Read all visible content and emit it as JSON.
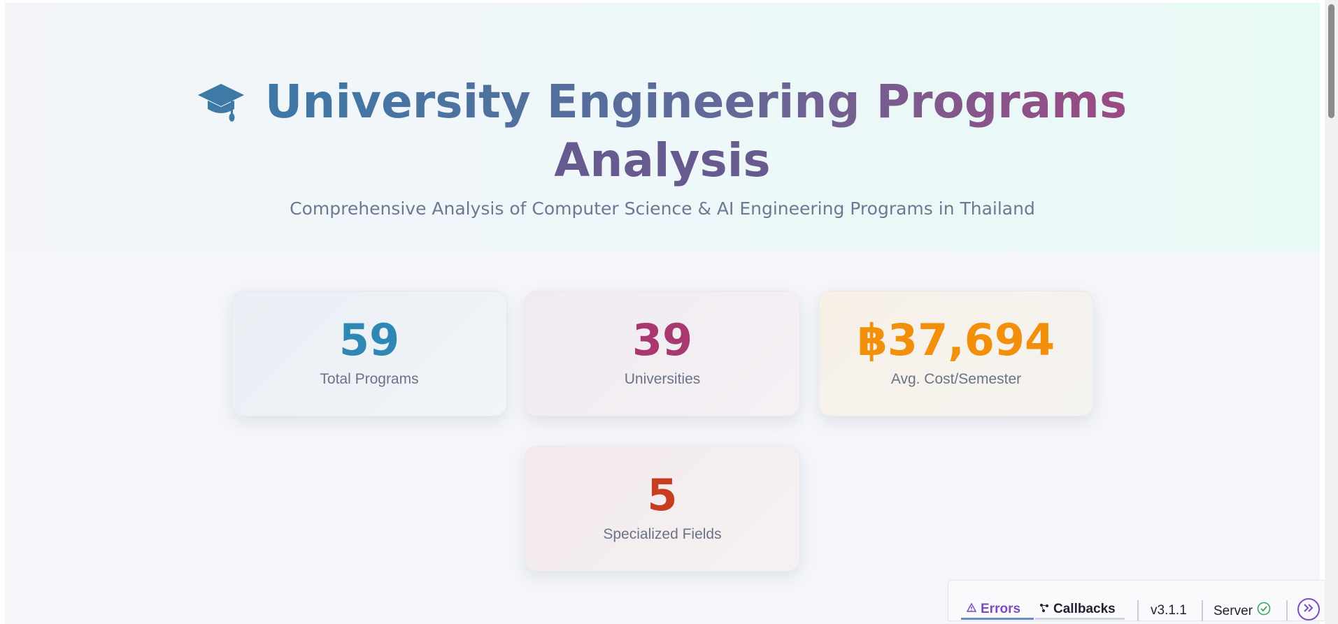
{
  "header": {
    "title_line1": "University Engineering Programs",
    "title_line2": "Analysis",
    "subtitle": "Comprehensive Analysis of Computer Science & AI Engineering Programs in Thailand",
    "icon": "graduation-cap-icon"
  },
  "stats": [
    {
      "value": "59",
      "label": "Total Programs",
      "color": "#2f87b3"
    },
    {
      "value": "39",
      "label": "Universities",
      "color": "#a8386f"
    },
    {
      "value": "฿37,694",
      "label": "Avg. Cost/Semester",
      "color": "#f2900c"
    },
    {
      "value": "5",
      "label": "Specialized Fields",
      "color": "#c83c20"
    }
  ],
  "devtools": {
    "errors_label": "Errors",
    "callbacks_label": "Callbacks",
    "version": "v3.1.1",
    "server_label": "Server",
    "errors_color": "#7b4bc2",
    "server_status_color": "#3aa55c"
  }
}
